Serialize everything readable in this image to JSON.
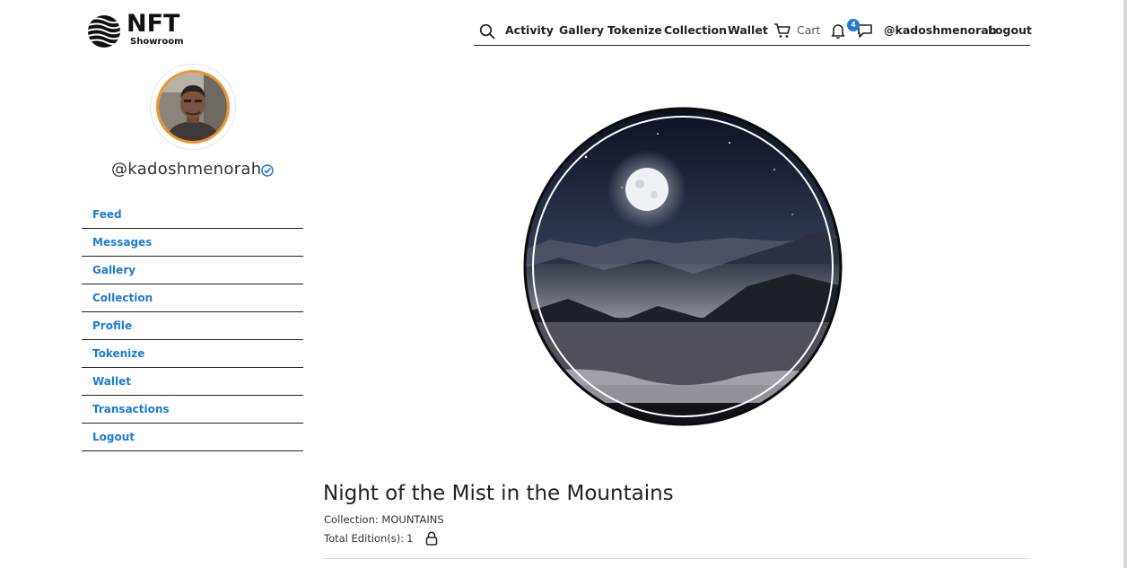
{
  "brand": {
    "name": "NFT",
    "sub": "Showroom",
    "icon": "striped-sphere-logo"
  },
  "header": {
    "nav": {
      "search_icon": "search-icon",
      "activity": "Activity",
      "gallery": "Gallery",
      "tokenize": "Tokenize",
      "collection": "Collection",
      "wallet": "Wallet",
      "cart": "Cart",
      "notifications_count": "4",
      "username": "@kadoshmenorah",
      "logout": "Logout"
    }
  },
  "sidebar": {
    "username": "@kadoshmenorah",
    "verified_icon": "verified-check-icon",
    "items": [
      {
        "label": "Feed"
      },
      {
        "label": "Messages"
      },
      {
        "label": "Gallery"
      },
      {
        "label": "Collection"
      },
      {
        "label": "Profile"
      },
      {
        "label": "Tokenize"
      },
      {
        "label": "Wallet"
      },
      {
        "label": "Transactions"
      },
      {
        "label": "Logout"
      }
    ]
  },
  "artwork": {
    "title": "Night of the Mist in the Mountains",
    "collection_label": "Collection:",
    "collection": "MOUNTAINS",
    "editions_label": "Total Edition(s):",
    "editions": "1"
  },
  "colors": {
    "accent": "#1e7bd8",
    "avatar_ring": "#f0962a",
    "text": "#222222"
  }
}
